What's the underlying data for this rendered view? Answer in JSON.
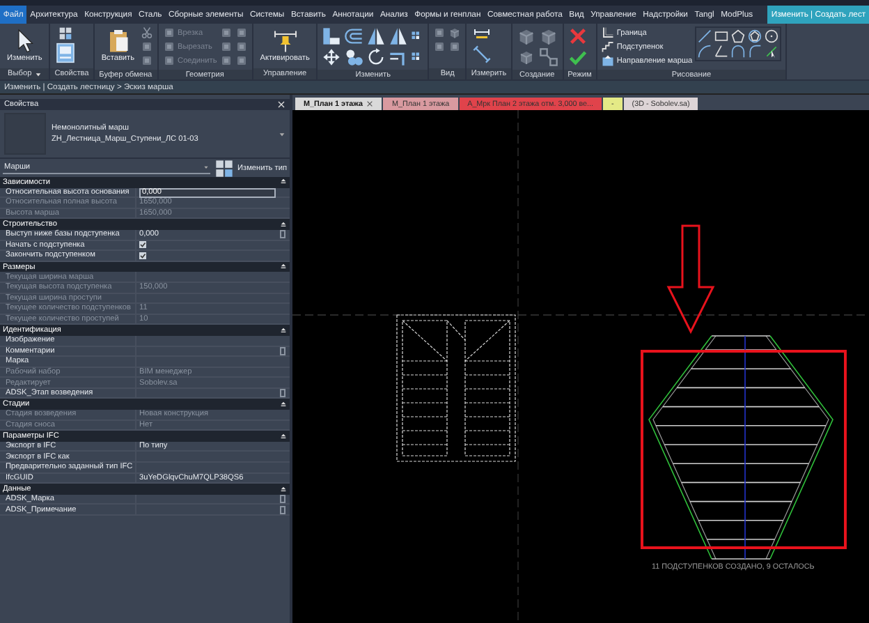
{
  "ribbon_tabs": [
    {
      "label": "Файл",
      "selected": false,
      "kind": "file"
    },
    {
      "label": "Архитектура",
      "selected": false,
      "kind": "normal"
    },
    {
      "label": "Конструкция",
      "selected": false,
      "kind": "normal"
    },
    {
      "label": "Сталь",
      "selected": false,
      "kind": "normal"
    },
    {
      "label": "Сборные элементы",
      "selected": false,
      "kind": "normal"
    },
    {
      "label": "Системы",
      "selected": false,
      "kind": "normal"
    },
    {
      "label": "Вставить",
      "selected": false,
      "kind": "normal"
    },
    {
      "label": "Аннотации",
      "selected": false,
      "kind": "normal"
    },
    {
      "label": "Анализ",
      "selected": false,
      "kind": "normal"
    },
    {
      "label": "Формы и генплан",
      "selected": false,
      "kind": "normal"
    },
    {
      "label": "Совместная работа",
      "selected": false,
      "kind": "normal"
    },
    {
      "label": "Вид",
      "selected": false,
      "kind": "normal"
    },
    {
      "label": "Управление",
      "selected": false,
      "kind": "normal"
    },
    {
      "label": "Надстройки",
      "selected": false,
      "kind": "normal"
    },
    {
      "label": "Tangl",
      "selected": false,
      "kind": "normal"
    },
    {
      "label": "ModPlus",
      "selected": false,
      "kind": "normal"
    },
    {
      "label": "Изменить | Создать лест",
      "selected": true,
      "kind": "context"
    }
  ],
  "ribbon_panels": [
    {
      "label": "Выбор",
      "large": [
        {
          "label": "Изменить"
        }
      ]
    },
    {
      "label": "Свойства"
    },
    {
      "label": "Буфер обмена",
      "large": [
        {
          "label": "Вставить"
        }
      ]
    },
    {
      "label": "Геометрия",
      "small": [
        {
          "label": "Врезка",
          "disabled": true
        },
        {
          "label": "Вырезать",
          "disabled": true
        },
        {
          "label": "Соединить",
          "disabled": true
        }
      ]
    },
    {
      "label": "Управление",
      "large": [
        {
          "label": "Активировать"
        }
      ]
    },
    {
      "label": "Изменить"
    },
    {
      "label": "Вид"
    },
    {
      "label": "Измерить"
    },
    {
      "label": "Создание"
    },
    {
      "label": "Режим"
    },
    {
      "label": "Рисование",
      "small": [
        {
          "label": "Граница",
          "disabled": false
        },
        {
          "label": "Подступенок",
          "disabled": false
        },
        {
          "label": "Направление марша",
          "disabled": false
        }
      ]
    }
  ],
  "breadcrumb": "Изменить | Создать лестницу > Эскиз марша",
  "properties": {
    "title": "Свойства",
    "type_family": "Немонолитный марш",
    "type_name": "ZH_Лестница_Марш_Ступени_ЛС 01-03",
    "filter": "Марши",
    "edit_type": "Изменить тип",
    "groups": [
      {
        "name": "Зависимости",
        "rows": [
          {
            "label": "Относительная высота основания",
            "value": "0,000",
            "kind": "input",
            "disabled": false
          },
          {
            "label": "Относительная полная высота",
            "value": "1650,000",
            "kind": "text",
            "disabled": true
          },
          {
            "label": "Высота марша",
            "value": "1650,000",
            "kind": "text",
            "disabled": true
          }
        ]
      },
      {
        "name": "Строительство",
        "rows": [
          {
            "label": "Выступ ниже базы подступенка",
            "value": "0,000",
            "kind": "linked",
            "disabled": false
          },
          {
            "label": "Начать с подступенка",
            "checked": true,
            "kind": "checkbox",
            "disabled": false
          },
          {
            "label": "Закончить подступенком",
            "checked": true,
            "kind": "checkbox",
            "disabled": false
          }
        ]
      },
      {
        "name": "Размеры",
        "rows": [
          {
            "label": "Текущая ширина марша",
            "kind": "text",
            "disabled": true
          },
          {
            "label": "Текущая высота подступенка",
            "value": "150,000",
            "kind": "text",
            "disabled": true
          },
          {
            "label": "Текущая ширина проступи",
            "kind": "text",
            "disabled": true
          },
          {
            "label": "Текущее количество подступенков",
            "value": "11",
            "kind": "text",
            "disabled": true
          },
          {
            "label": "Текущее количество проступей",
            "value": "10",
            "kind": "text",
            "disabled": true
          }
        ]
      },
      {
        "name": "Идентификация",
        "rows": [
          {
            "label": "Изображение",
            "kind": "text",
            "disabled": false
          },
          {
            "label": "Комментарии",
            "kind": "linked",
            "disabled": false
          },
          {
            "label": "Марка",
            "kind": "text",
            "disabled": false
          },
          {
            "label": "Рабочий набор",
            "value": "BIM менеджер",
            "kind": "text",
            "disabled": true
          },
          {
            "label": "Редактирует",
            "value": "Sobolev.sa",
            "kind": "text",
            "disabled": true
          },
          {
            "label": "ADSK_Этап возведения",
            "kind": "linked",
            "disabled": false
          }
        ]
      },
      {
        "name": "Стадии",
        "rows": [
          {
            "label": "Стадия возведения",
            "value": "Новая конструкция",
            "kind": "text",
            "disabled": true
          },
          {
            "label": "Стадия сноса",
            "value": "Нет",
            "kind": "text",
            "disabled": true
          }
        ]
      },
      {
        "name": "Параметры IFC",
        "rows": [
          {
            "label": "Экспорт в IFC",
            "value": "По типу",
            "kind": "text",
            "disabled": false
          },
          {
            "label": "Экспорт в IFC как",
            "kind": "text",
            "disabled": false
          },
          {
            "label": "Предварительно заданный тип IFC",
            "kind": "text",
            "disabled": false
          },
          {
            "label": "IfcGUID",
            "value": "3uYeDGlqvChuM7QLP38QS6",
            "kind": "text",
            "disabled": false
          }
        ]
      },
      {
        "name": "Данные",
        "rows": [
          {
            "label": "ADSK_Марка",
            "kind": "linked",
            "disabled": false
          },
          {
            "label": "ADSK_Примечание",
            "kind": "linked",
            "disabled": false
          }
        ]
      }
    ]
  },
  "view_tabs": [
    {
      "label": "M_План 1 этажа",
      "color": "#d9d9d9",
      "selected": true
    },
    {
      "label": "M_План 1 этажа",
      "color": "#d99aa0",
      "selected": false
    },
    {
      "label": "A_Мрк План 2 этажа отм. 3,000 ве...",
      "color": "#e0434b",
      "selected": false
    },
    {
      "label": "-",
      "color": "#e4ea86",
      "selected": false
    },
    {
      "label": "(3D - Sobolev.sa)",
      "color": "#ddd4d6",
      "selected": false
    }
  ],
  "canvas": {
    "status": "11 ПОДСТУПЕНКОВ СОЗДАНО, 9 ОСТАЛОСЬ"
  }
}
